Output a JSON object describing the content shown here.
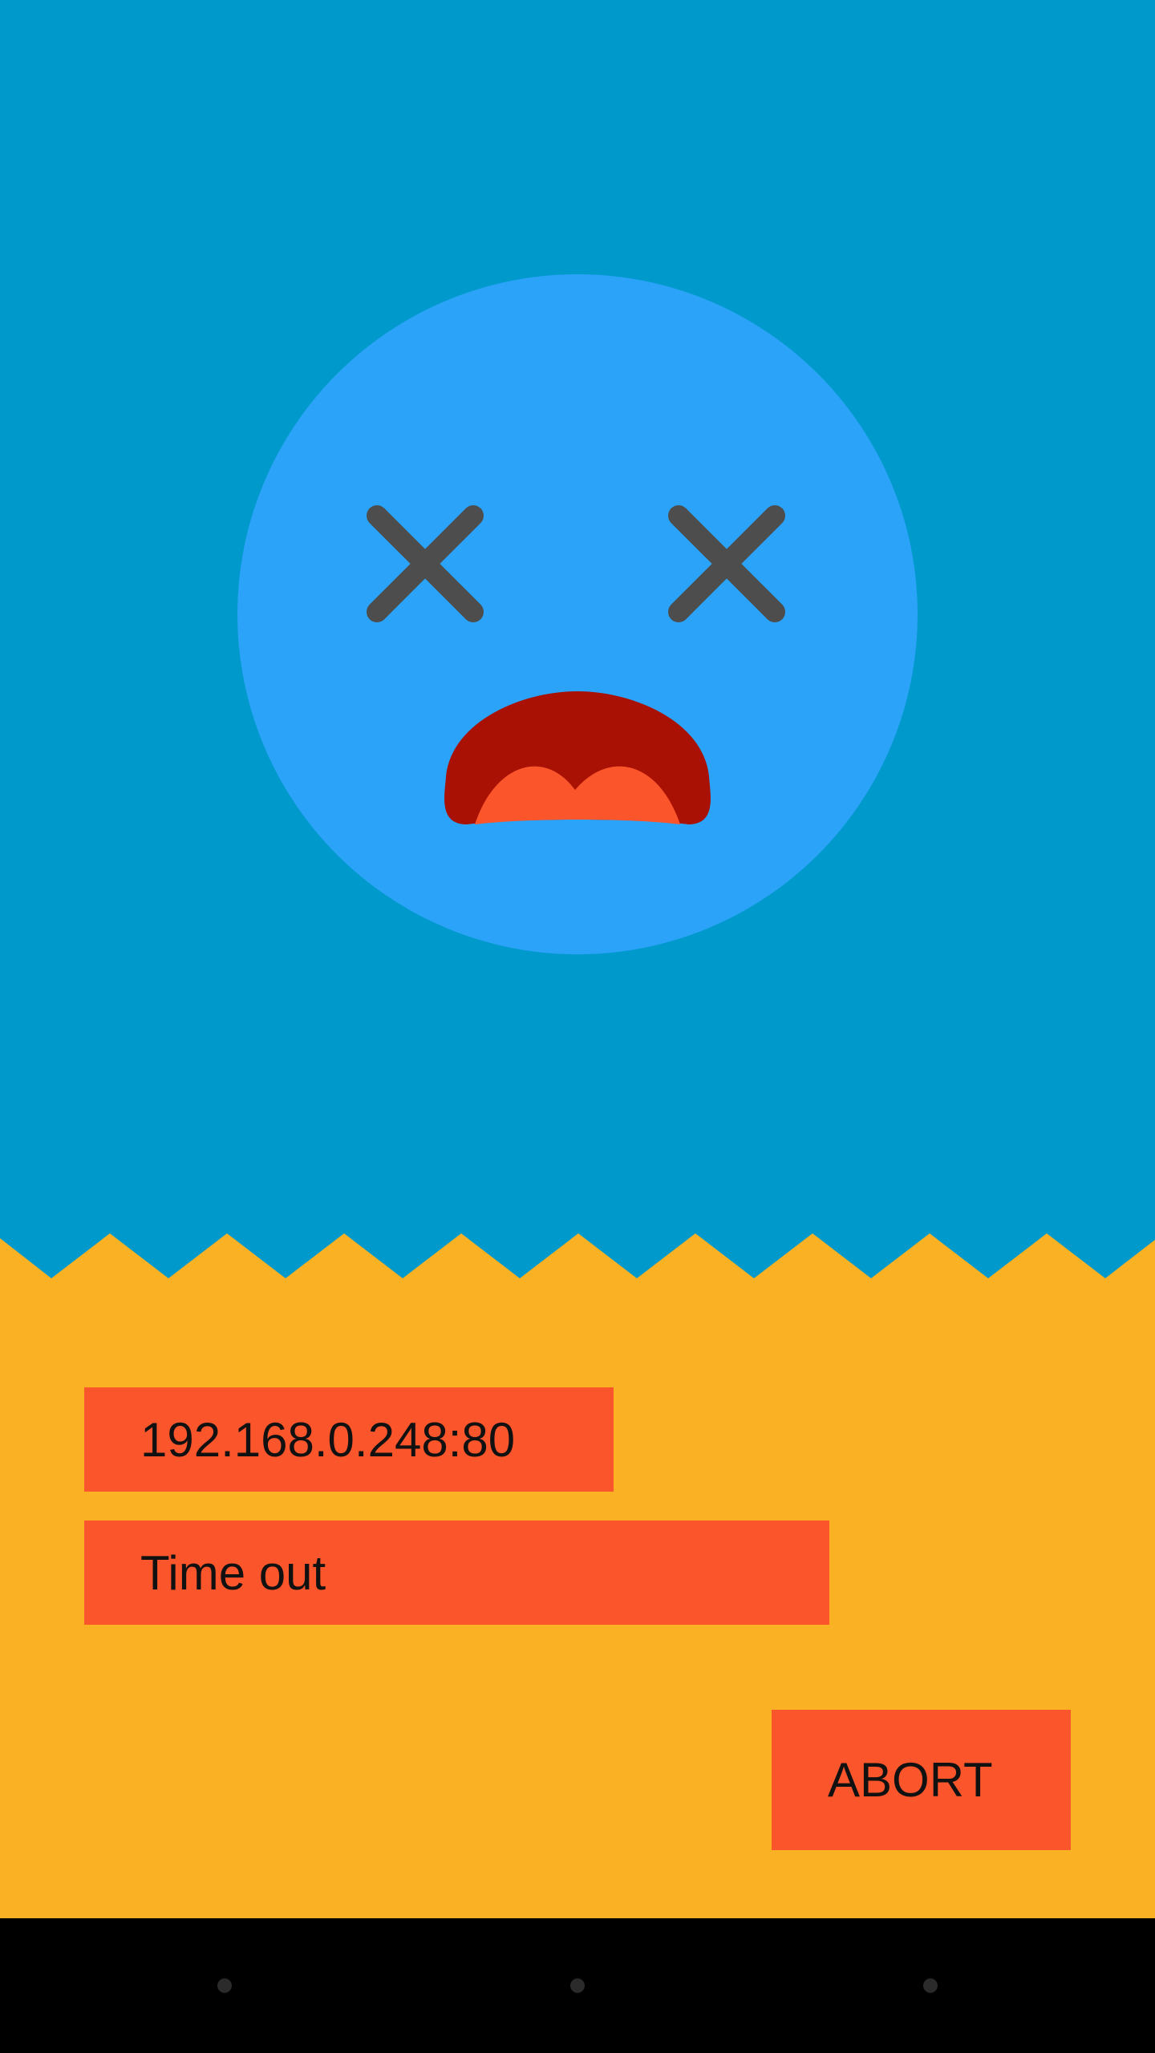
{
  "colors": {
    "sky": "#0099CC",
    "face": "#2BA3F8",
    "eyes": "#4D4D4D",
    "mouth": "#A91105",
    "tongue": "#FA552B",
    "ground": "#FAB224",
    "chip": "#FA552B",
    "button": "#FA552B",
    "nav_bar": "#000000"
  },
  "illustration": {
    "face_icon": "dead-face-icon",
    "eye_icon": "x-eye-icon",
    "mouth_icon": "open-mouth-icon"
  },
  "connection": {
    "address": "192.168.0.248:80",
    "error": "Time out"
  },
  "actions": {
    "abort_label": "ABORT"
  },
  "nav": {
    "back_icon": "back-icon",
    "home_icon": "home-icon",
    "recents_icon": "recents-icon"
  }
}
